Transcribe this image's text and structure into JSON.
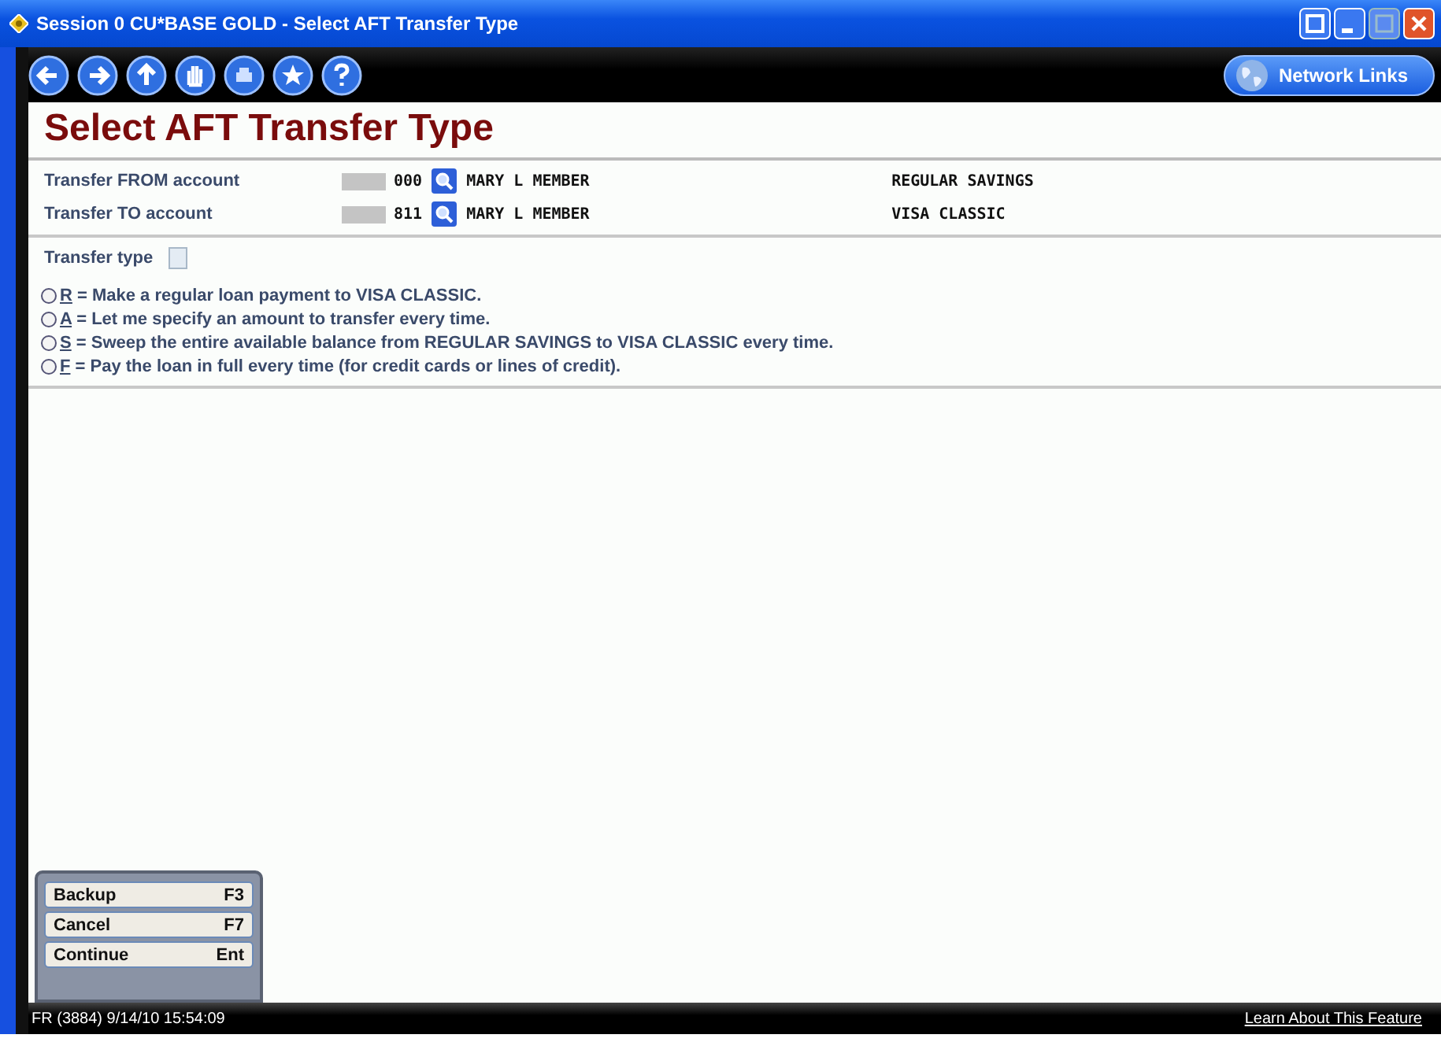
{
  "window": {
    "title": "Session 0 CU*BASE GOLD - Select AFT Transfer Type"
  },
  "network_links": {
    "label": "Network Links"
  },
  "heading": "Select AFT Transfer Type",
  "accounts": [
    {
      "label": "Transfer FROM account",
      "suffix": "000",
      "member": "MARY L MEMBER",
      "account_type": "REGULAR SAVINGS"
    },
    {
      "label": "Transfer TO account",
      "suffix": "811",
      "member": "MARY L MEMBER",
      "account_type": "VISA CLASSIC"
    }
  ],
  "transfer_type": {
    "label": "Transfer type"
  },
  "options": [
    {
      "letter": "R",
      "text": " = Make a regular loan payment to VISA CLASSIC.",
      "selected": false
    },
    {
      "letter": "A",
      "text": " = Let me specify an amount to transfer every time.",
      "selected": false
    },
    {
      "letter": "S",
      "text": " = Sweep the entire available balance from REGULAR SAVINGS to VISA CLASSIC every time.",
      "selected": false
    },
    {
      "letter": "F",
      "text": " = Pay the loan in full every time (for credit cards or lines of credit).",
      "selected": false
    }
  ],
  "function_keys": [
    {
      "label": "Backup",
      "key": "F3"
    },
    {
      "label": "Cancel",
      "key": "F7"
    },
    {
      "label": "Continue",
      "key": "Ent"
    }
  ],
  "status_bar": {
    "session": "FR (3884) 9/14/10 15:54:09",
    "link": "Learn About This Feature"
  }
}
